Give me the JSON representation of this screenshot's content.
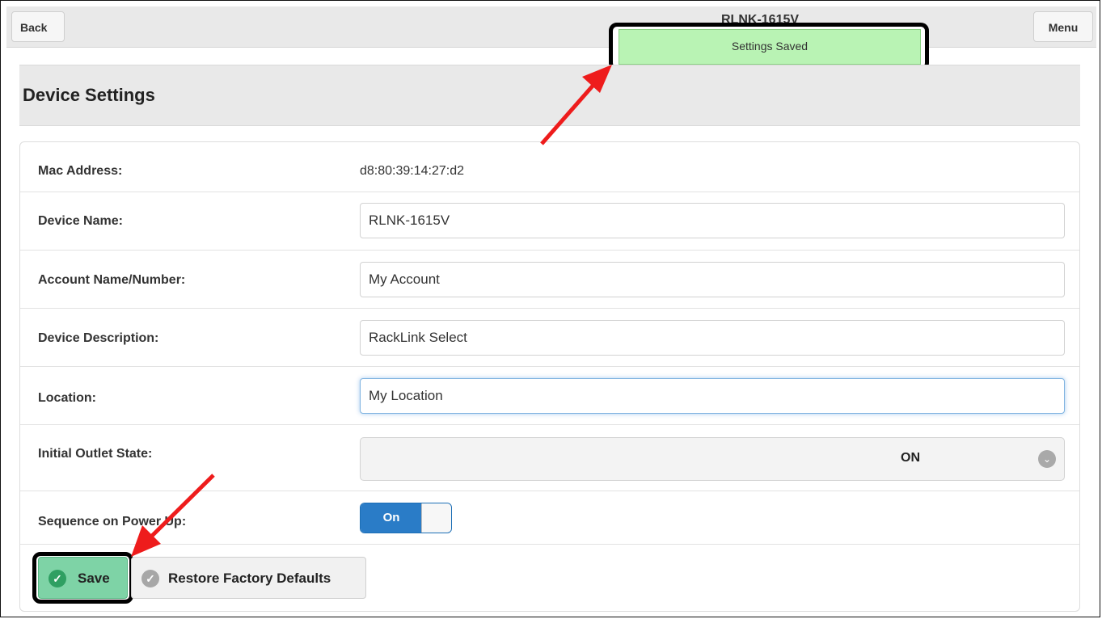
{
  "header": {
    "back_label": "Back",
    "menu_label": "Menu",
    "title": "RLNK-1615V"
  },
  "toast": {
    "message": "Settings Saved"
  },
  "page": {
    "title": "Device Settings"
  },
  "fields": {
    "mac": {
      "label": "Mac Address:",
      "value": "d8:80:39:14:27:d2"
    },
    "device_name": {
      "label": "Device Name:",
      "value": "RLNK-1615V"
    },
    "account": {
      "label": "Account Name/Number:",
      "value": "My Account"
    },
    "description": {
      "label": "Device Description:",
      "value": "RackLink Select"
    },
    "location": {
      "label": "Location:",
      "value": "My Location"
    },
    "outlet_state": {
      "label": "Initial Outlet State:",
      "value": "ON"
    },
    "sequence": {
      "label": "Sequence on Power Up:",
      "toggle_label": "On"
    }
  },
  "actions": {
    "save_label": "Save",
    "restore_label": "Restore Factory Defaults"
  },
  "colors": {
    "toast_bg": "#b9f3b4",
    "save_bg": "#7ed3a6",
    "toggle_blue": "#2a7cc7",
    "arrow_red": "#ee1c1c"
  },
  "icons": {
    "save": "check-circle-icon",
    "restore": "check-circle-icon",
    "select": "chevron-down-icon",
    "annotation": "red-arrow-icon"
  }
}
